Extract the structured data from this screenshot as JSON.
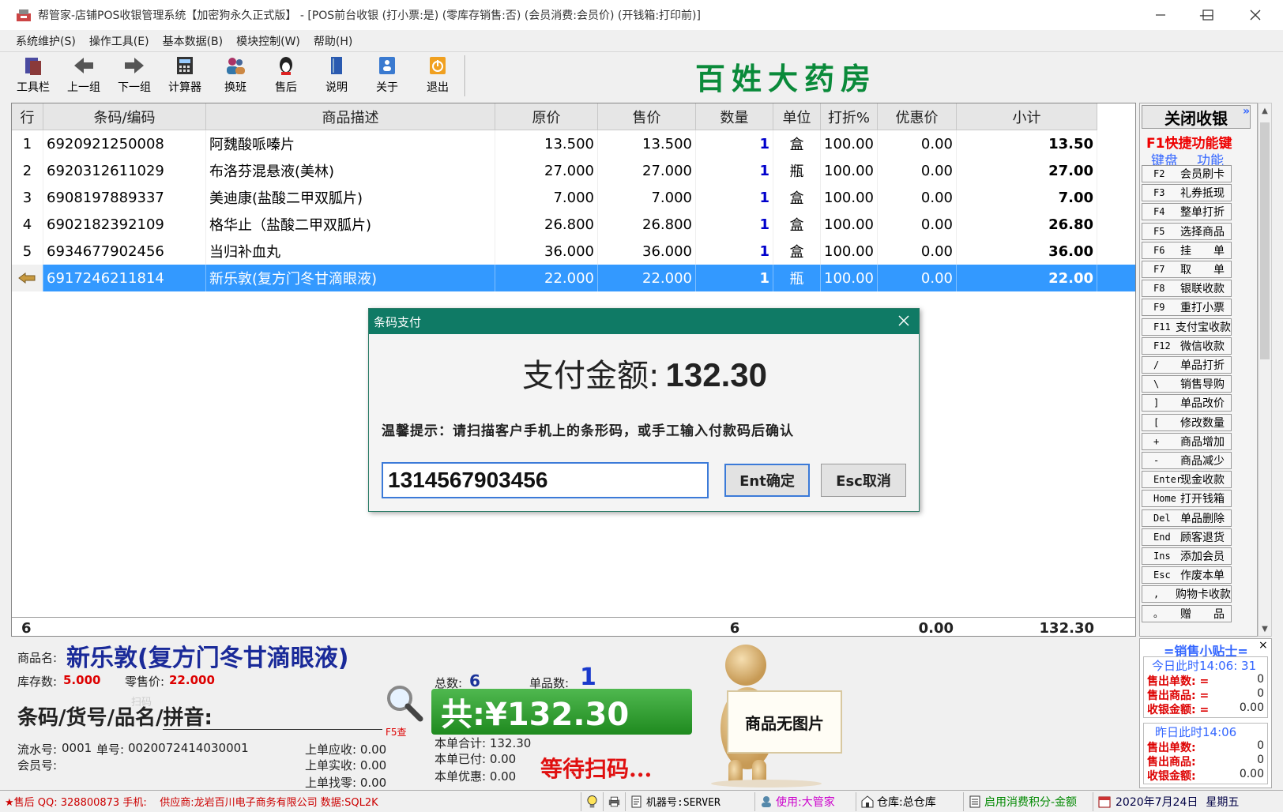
{
  "window": {
    "title": "帮管家-店铺POS收银管理系统【加密狗永久正式版】 - [POS前台收银 (打小票:是) (零库存销售:否) (会员消费:会员价) (开钱箱:打印前)]"
  },
  "menu": [
    "系统维护(S)",
    "操作工具(E)",
    "基本数据(B)",
    "模块控制(W)",
    "帮助(H)"
  ],
  "toolbar": [
    {
      "label": "工具栏",
      "icon": "toolbar-icon"
    },
    {
      "label": "上一组",
      "icon": "arrow-left-icon"
    },
    {
      "label": "下一组",
      "icon": "arrow-right-icon"
    },
    {
      "label": "计算器",
      "icon": "calculator-icon"
    },
    {
      "label": "换班",
      "icon": "users-icon"
    },
    {
      "label": "售后",
      "icon": "support-icon"
    },
    {
      "label": "说明",
      "icon": "book-icon"
    },
    {
      "label": "关于",
      "icon": "about-icon"
    },
    {
      "label": "退出",
      "icon": "exit-icon"
    }
  ],
  "store_name": "百姓大药房",
  "grid": {
    "headers": [
      "行",
      "条码/编码",
      "商品描述",
      "原价",
      "售价",
      "数量",
      "单位",
      "打折%",
      "优惠价",
      "小计"
    ],
    "rows": [
      {
        "no": "1",
        "code": "6920921250008",
        "desc": "阿魏酸哌嗪片",
        "orig": "13.500",
        "price": "13.500",
        "qty": "1",
        "unit": "盒",
        "disc": "100.00",
        "promo": "0.00",
        "sub": "13.50"
      },
      {
        "no": "2",
        "code": "6920312611029",
        "desc": "布洛芬混悬液(美林)",
        "orig": "27.000",
        "price": "27.000",
        "qty": "1",
        "unit": "瓶",
        "disc": "100.00",
        "promo": "0.00",
        "sub": "27.00"
      },
      {
        "no": "3",
        "code": "6908197889337",
        "desc": "美迪康(盐酸二甲双胍片)",
        "orig": "7.000",
        "price": "7.000",
        "qty": "1",
        "unit": "盒",
        "disc": "100.00",
        "promo": "0.00",
        "sub": "7.00"
      },
      {
        "no": "4",
        "code": "6902182392109",
        "desc": "格华止（盐酸二甲双胍片)",
        "orig": "26.800",
        "price": "26.800",
        "qty": "1",
        "unit": "盒",
        "disc": "100.00",
        "promo": "0.00",
        "sub": "26.80"
      },
      {
        "no": "5",
        "code": "6934677902456",
        "desc": "当归补血丸",
        "orig": "36.000",
        "price": "36.000",
        "qty": "1",
        "unit": "盒",
        "disc": "100.00",
        "promo": "0.00",
        "sub": "36.00"
      },
      {
        "no": "",
        "code": "6917246211814",
        "desc": "新乐敦(复方门冬甘滴眼液)",
        "orig": "22.000",
        "price": "22.000",
        "qty": "1",
        "unit": "瓶",
        "disc": "100.00",
        "promo": "0.00",
        "sub": "22.00"
      }
    ],
    "footer": {
      "count": "6",
      "qty": "6",
      "promo": "0.00",
      "sub": "132.30"
    }
  },
  "right_panel": {
    "close_label": "关闭收银",
    "more": "»",
    "f1": "F1快捷功能键",
    "kb_label": "键盘",
    "fn_label": "功能",
    "keys": [
      {
        "k": "F2",
        "v": "会员刷卡"
      },
      {
        "k": "F3",
        "v": "礼券抵现"
      },
      {
        "k": "F4",
        "v": "整单打折"
      },
      {
        "k": "F5",
        "v": "选择商品"
      },
      {
        "k": "F6",
        "v": "挂　　单"
      },
      {
        "k": "F7",
        "v": "取　　单"
      },
      {
        "k": "F8",
        "v": "银联收款"
      },
      {
        "k": "F9",
        "v": "重打小票"
      },
      {
        "k": "F11",
        "v": "支付宝收款"
      },
      {
        "k": "F12",
        "v": "微信收款"
      },
      {
        "k": "/",
        "v": "单品打折"
      },
      {
        "k": "\\",
        "v": "销售导购"
      },
      {
        "k": "]",
        "v": "单品改价"
      },
      {
        "k": "[",
        "v": "修改数量"
      },
      {
        "k": "+",
        "v": "商品增加"
      },
      {
        "k": "-",
        "v": "商品减少"
      },
      {
        "k": "Enter",
        "v": "现金收款"
      },
      {
        "k": "Home",
        "v": "打开钱箱"
      },
      {
        "k": "Del",
        "v": "单品删除"
      },
      {
        "k": "End",
        "v": "顾客退货"
      },
      {
        "k": "Ins",
        "v": "添加会员"
      },
      {
        "k": "Esc",
        "v": "作废本单"
      },
      {
        "k": ",",
        "v": "购物卡收款"
      },
      {
        "k": "。",
        "v": "赠　　品"
      }
    ]
  },
  "info": {
    "name_label": "商品名:",
    "name": "新乐敦(复方门冬甘滴眼液)",
    "stock_label": "库存数:",
    "stock": "5.000",
    "retail_label": "零售价:",
    "retail": "22.000",
    "total_count_label": "总数:",
    "total_count": "6",
    "item_count_label": "单品数:",
    "item_count": "1",
    "scan_label": "条码/货号/品名/拼音:",
    "scan_hint": "扫码",
    "f5_label": "F5查",
    "total_display": "共:¥132.30",
    "serial_label": "流水号:",
    "serial": "0001",
    "order_label": "单号:",
    "order": "0020072414030001",
    "member_label": "会员号:",
    "prev_due": "上单应收: 0.00",
    "prev_paid": "上单实收: 0.00",
    "prev_change": "上单找零: 0.00",
    "this_total": "本单合计: 132.30",
    "this_paid": "本单已付: 0.00",
    "this_discount": "本单优惠: 0.00",
    "waiting": "等待扫码...",
    "no_image": "商品无图片"
  },
  "stats": {
    "title": "=销售小贴士=",
    "close": "×",
    "today": {
      "title": "今日此时14:06: 31",
      "orders": "0",
      "items": "0",
      "amount": "0.00"
    },
    "yesterday": {
      "title": "昨日此时14:06",
      "orders": "0",
      "items": "0",
      "amount": "0.00"
    },
    "orders_label": "售出单数: =",
    "items_label": "售出商品: =",
    "amount_label": "收银金额: =",
    "orders_label2": "售出单数:",
    "items_label2": "售出商品:",
    "amount_label2": "收银金额:"
  },
  "status": {
    "support": "★售后 QQ: 328800873 手机:",
    "supplier": "供应商:龙岩百川电子商务有限公司 数据:SQL2K",
    "machine": "机器号:SERVER",
    "user": "使用:大管家",
    "warehouse": "仓库:总仓库",
    "points": "启用消费积分-金额",
    "date": "2020年7月24日",
    "weekday": "星期五"
  },
  "modal": {
    "title": "条码支付",
    "amount_label": "支付金额:",
    "amount": "132.30",
    "tip": "温馨提示：请扫描客户手机上的条形码，或手工输入付款码后确认",
    "input_value": "1314567903456",
    "ok": "Ent确定",
    "cancel": "Esc取消"
  }
}
